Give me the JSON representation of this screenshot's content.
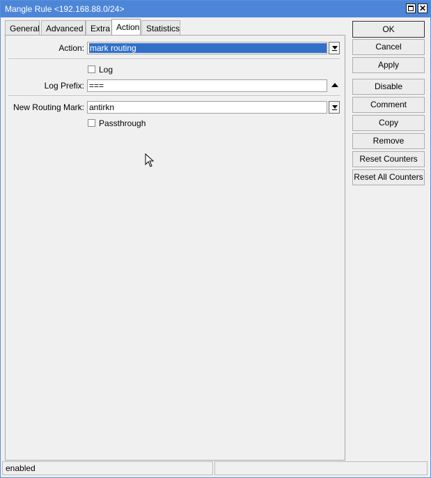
{
  "window": {
    "title": "Mangle Rule <192.168.88.0/24>",
    "maximize_icon": "maximize-icon",
    "close_icon": "close-icon"
  },
  "tabs": [
    {
      "label": "General"
    },
    {
      "label": "Advanced"
    },
    {
      "label": "Extra"
    },
    {
      "label": "Action",
      "active": true
    },
    {
      "label": "Statistics"
    }
  ],
  "form": {
    "action": {
      "label": "Action:",
      "value": "mark routing"
    },
    "log": {
      "label": "Log",
      "checked": false
    },
    "log_prefix": {
      "label": "Log Prefix:",
      "value": "==="
    },
    "new_routing_mark": {
      "label": "New Routing Mark:",
      "value": "antirkn"
    },
    "passthrough": {
      "label": "Passthrough",
      "checked": false
    }
  },
  "buttons": {
    "ok": "OK",
    "cancel": "Cancel",
    "apply": "Apply",
    "disable": "Disable",
    "comment": "Comment",
    "copy": "Copy",
    "remove": "Remove",
    "reset_counters": "Reset Counters",
    "reset_all_counters": "Reset All Counters"
  },
  "status": {
    "left": "enabled",
    "right": ""
  },
  "colors": {
    "titlebar": "#4d86d8",
    "selection": "#3070c8"
  }
}
